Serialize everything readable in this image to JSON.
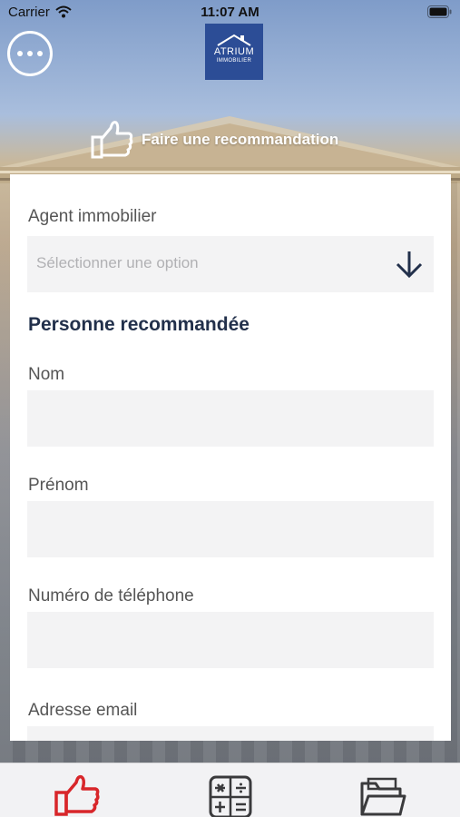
{
  "status_bar": {
    "carrier": "Carrier",
    "time": "11:07 AM"
  },
  "header": {
    "menu_icon": "ellipsis-icon",
    "logo": {
      "name": "ATRIUM",
      "subtitle": "IMMOBILIER",
      "color": "#2c4d96"
    },
    "title": "Faire une recommandation",
    "title_icon": "thumbs-up-icon"
  },
  "form": {
    "agent_label": "Agent immobilier",
    "agent_select": {
      "placeholder": "Sélectionner une option",
      "icon": "arrow-down-icon"
    },
    "section_title": "Personne recommandée",
    "fields": [
      {
        "label": "Nom",
        "value": ""
      },
      {
        "label": "Prénom",
        "value": ""
      },
      {
        "label": "Numéro de téléphone",
        "value": ""
      },
      {
        "label": "Adresse email",
        "value": ""
      }
    ]
  },
  "tabbar": {
    "tabs": [
      {
        "icon": "thumbs-up-icon",
        "active": true,
        "color": "#d8262a"
      },
      {
        "icon": "calculator-icon",
        "active": false,
        "color": "#3a3a3c"
      },
      {
        "icon": "folder-icon",
        "active": false,
        "color": "#3a3a3c"
      }
    ]
  },
  "colors": {
    "accent_dark": "#22304b",
    "field_bg": "#f3f3f4",
    "tab_active": "#d8262a"
  }
}
